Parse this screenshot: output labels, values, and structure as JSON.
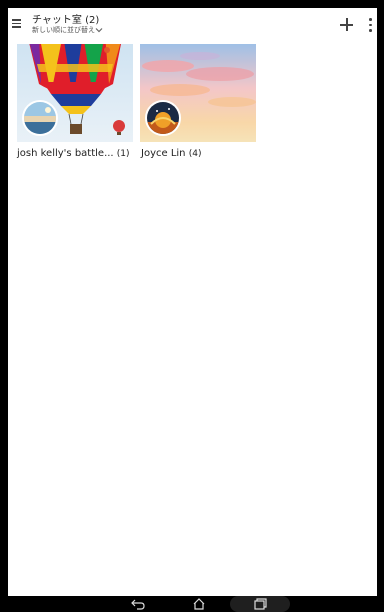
{
  "header": {
    "title": "チャット室 (2)",
    "subtitle": "新しい順に並び替え"
  },
  "chats": [
    {
      "name": "josh kelly's battle...",
      "count": "(1)"
    },
    {
      "name": "Joyce Lin",
      "count": "(4)"
    }
  ],
  "icons": {
    "menu": "menu-icon",
    "sort": "chevron-down-icon",
    "add": "plus-icon",
    "more": "more-vert-icon",
    "back": "back-icon",
    "home": "home-icon",
    "recent": "recent-apps-icon"
  }
}
